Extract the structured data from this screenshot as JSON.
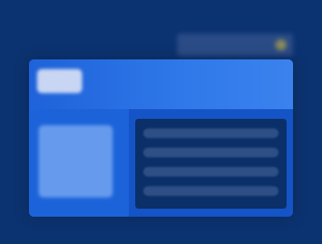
{
  "colors": {
    "background": "#0c3371",
    "window": "#1554c7",
    "header": "#2f79ea",
    "sidebar": "#1c63da",
    "content": "#0b2f68"
  },
  "icons": {
    "logo": "logo-icon",
    "status": "status-dot-icon"
  }
}
